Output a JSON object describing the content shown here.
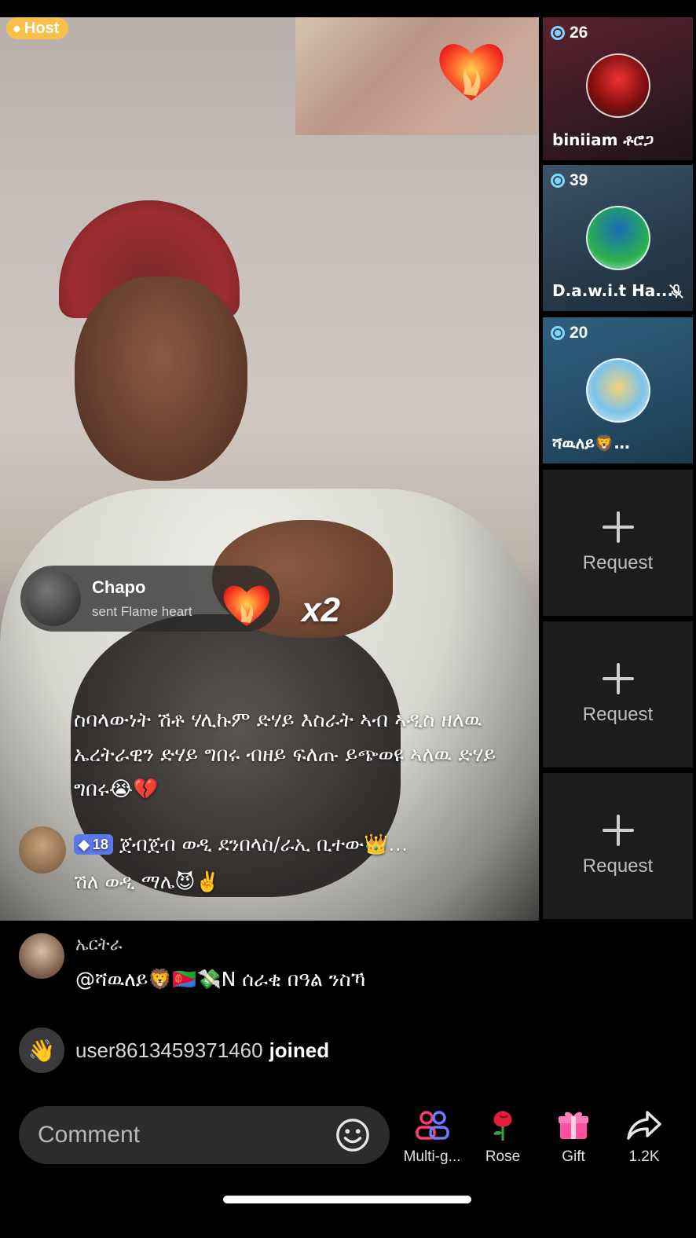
{
  "host": {
    "label": "Host"
  },
  "video": {
    "gift_notification": {
      "user": "Chapo",
      "description": "sent Flame heart",
      "count": "x2"
    },
    "overlay_comment": {
      "text": "ስባላውነት ሽቶ ሃሊኩም ድሃይ እስራት ኣብ ኣዲስ ዘለዉ ኤረትራዊን ድሃይ ግበሩ ብዘይ ፍለጡ ይጭወዩ ኣለዉ ድሃይ ግበሩ😭💔"
    },
    "badge_comment": {
      "level": "18",
      "line1": "ጀብጀብ ወዲ ደንበላስ/ራኢ ቢተው👑…",
      "line2": "ሽለ ወዲ ማሌ😈✌️"
    }
  },
  "guests": [
    {
      "count": "26",
      "name": "biniiam ቶሮጋ",
      "muted": false
    },
    {
      "count": "39",
      "name": "D.a.w.i.t Ha...",
      "muted": true
    },
    {
      "count": "20",
      "name": "ሻዉለይ🦁…",
      "muted": false
    }
  ],
  "requests": [
    {
      "label": "Request"
    },
    {
      "label": "Request"
    },
    {
      "label": "Request"
    }
  ],
  "chat": [
    {
      "user": "ኤርትራ",
      "message": "@ሻዉለይ🦁🇪🇷💸N ሰራቂ በዓል ንስኻ"
    }
  ],
  "join_event": {
    "user": "user8613459371460",
    "action": "joined"
  },
  "bottom_bar": {
    "comment_placeholder": "Comment",
    "actions": [
      {
        "label": "Multi-g...",
        "icon": "multi-guest-icon"
      },
      {
        "label": "Rose",
        "icon": "rose-icon"
      },
      {
        "label": "Gift",
        "icon": "gift-icon"
      },
      {
        "label": "1.2K",
        "icon": "share-icon"
      }
    ]
  },
  "colors": {
    "host_badge": "#f7c04a",
    "level_badge": "#5b79e8",
    "viewer_ring": "#7fd6ff",
    "multi_guest_pink": "#ff3b6f",
    "gift_pink": "#ff4fa0"
  }
}
